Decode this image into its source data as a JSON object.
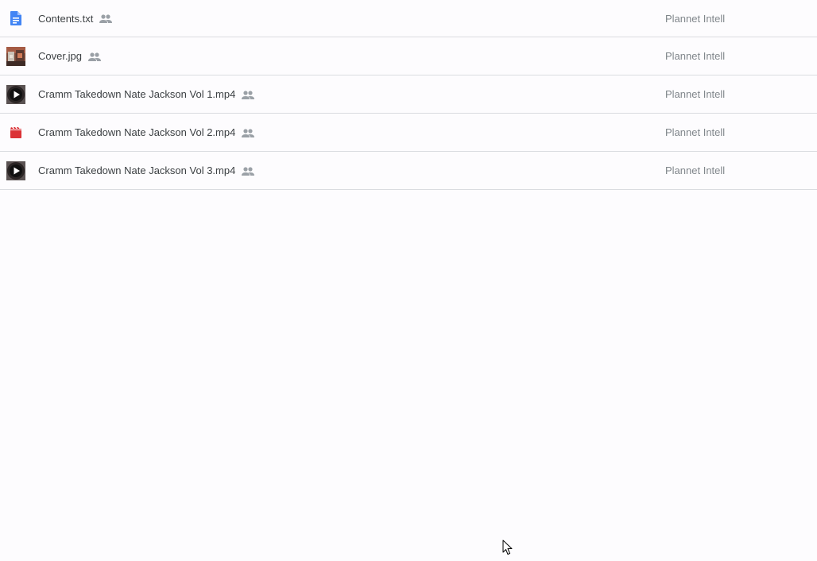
{
  "files": [
    {
      "name": "Contents.txt",
      "owner": "Plannet Intell",
      "icon": "doc-icon",
      "shared": true
    },
    {
      "name": "Cover.jpg",
      "owner": "Plannet Intell",
      "icon": "image-thumbnail",
      "shared": true
    },
    {
      "name": "Cramm Takedown Nate Jackson Vol 1.mp4",
      "owner": "Plannet Intell",
      "icon": "video-thumbnail",
      "shared": true
    },
    {
      "name": "Cramm Takedown Nate Jackson Vol 2.mp4",
      "owner": "Plannet Intell",
      "icon": "video-file-icon",
      "shared": true
    },
    {
      "name": "Cramm Takedown Nate Jackson Vol 3.mp4",
      "owner": "Plannet Intell",
      "icon": "video-thumbnail",
      "shared": true
    }
  ],
  "colors": {
    "doc_blue": "#4285f4",
    "video_red": "#db3236",
    "shared_gray": "#9aa0a6",
    "owner_text": "#80868b",
    "divider": "#dadce0"
  }
}
